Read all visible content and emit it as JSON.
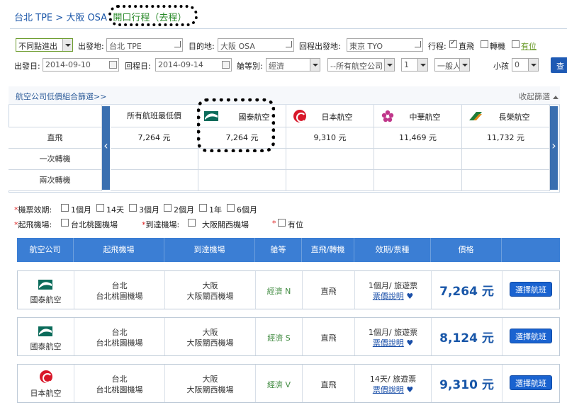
{
  "breadcrumb": {
    "origin": "台北 TPE",
    "sep": " > ",
    "dest": "大阪 OSA",
    "status": "開口行程（去程）"
  },
  "search": {
    "mode": "不同點進出",
    "from_label": "出發地:",
    "from_value": "台北 TPE",
    "to_label": "目的地:",
    "to_value": "大阪 OSA",
    "return_from_label": "回程出發地:",
    "return_from_value": "東京 TYO",
    "trip_label": "行程:",
    "opt_direct": "直飛",
    "opt_transfer": "轉機",
    "opt_avail": "有位",
    "depart_label": "出發日:",
    "depart_value": "2014-09-10",
    "return_label": "回程日:",
    "return_value": "2014-09-14",
    "class_label": "艙等別:",
    "class_value": "經濟",
    "airline_value": "--所有航空公司",
    "count_value": "1",
    "pax_value": "一般人士",
    "child_label": "小孩",
    "child_value": "0",
    "search_btn": "查"
  },
  "lowprice": {
    "title": "航空公司低價組合篩選>>",
    "collapse": "收起篩選",
    "columns": [
      "所有航班最低價",
      "國泰航空",
      "日本航空",
      "中華航空",
      "長榮航空"
    ],
    "rows": [
      {
        "label": "直飛",
        "values": [
          "7,264 元",
          "7,264 元",
          "9,310 元",
          "11,469 元",
          "11,732 元"
        ]
      },
      {
        "label": "一次轉機",
        "values": [
          "",
          "",
          "",
          "",
          ""
        ]
      },
      {
        "label": "兩次轉機",
        "values": [
          "",
          "",
          "",
          "",
          ""
        ]
      }
    ],
    "prev": "‹",
    "next": "›"
  },
  "filters": {
    "validity_label": "機票效期:",
    "validity_options": [
      "1個月",
      "14天",
      "3個月",
      "2個月",
      "1年",
      "6個月"
    ],
    "dep_airport_label": "起飛機場:",
    "dep_airport": "台北桃園機場",
    "arr_airport_label": "到達機場:",
    "arr_airport": "大阪關西機場",
    "seat_label": "有位"
  },
  "table": {
    "headers": [
      "航空公司",
      "起飛機場",
      "到達機場",
      "艙等",
      "直飛/轉機",
      "效期/票種",
      "價格"
    ],
    "rows": [
      {
        "airline": "國泰航空",
        "dep_city": "台北",
        "dep_airport": "台北桃園機場",
        "arr_city": "大阪",
        "arr_airport": "大阪關西機場",
        "class": "經濟 N",
        "route": "直飛",
        "validity": "1個月/ 旅遊票",
        "fare_link": "票價說明",
        "price": "7,264 元",
        "button": "選擇航班",
        "logo": "cathay-logo"
      },
      {
        "airline": "國泰航空",
        "dep_city": "台北",
        "dep_airport": "台北桃園機場",
        "arr_city": "大阪",
        "arr_airport": "大阪關西機場",
        "class": "經濟 S",
        "route": "直飛",
        "validity": "1個月/ 旅遊票",
        "fare_link": "票價說明",
        "price": "8,124 元",
        "button": "選擇航班",
        "logo": "cathay-logo"
      },
      {
        "airline": "日本航空",
        "dep_city": "台北",
        "dep_airport": "台北桃園機場",
        "arr_city": "大阪",
        "arr_airport": "大阪關西機場",
        "class": "經濟 V",
        "route": "直飛",
        "validity": "14天/ 旅遊票",
        "fare_link": "票價說明",
        "price": "9,310 元",
        "button": "選擇航班",
        "logo": "jal-logo"
      }
    ]
  },
  "colors": {
    "accent": "#3b7ed4",
    "price": "#1856a8",
    "button": "#1a63d0"
  }
}
